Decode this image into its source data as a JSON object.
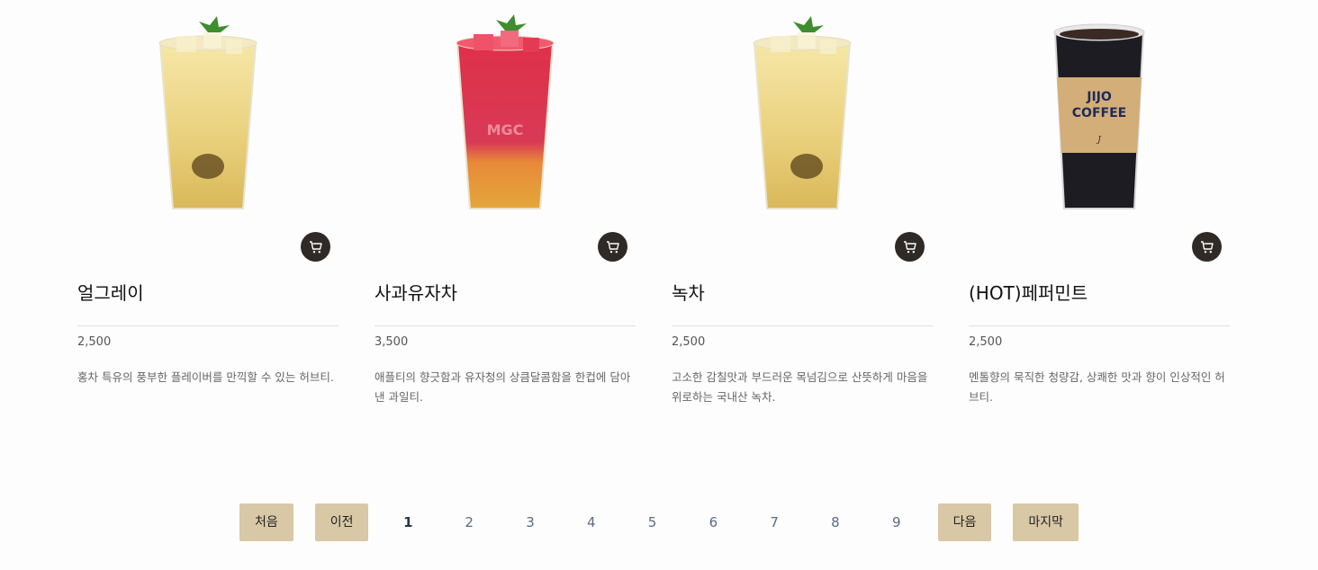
{
  "products": [
    {
      "name": "얼그레이",
      "price": "2,500",
      "description": "홍차 특유의 풍부한 플레이버를 만끽할 수 있는 허브티.",
      "image_icon": "iced-earl-grey-tea-drink"
    },
    {
      "name": "사과유자차",
      "price": "3,500",
      "description": "애플티의 향긋함과 유자청의 상큼달콤함을 한컵에 담아낸 과일티.",
      "image_icon": "iced-apple-yuzu-tea-drink",
      "cup_logo": "MGC"
    },
    {
      "name": "녹차",
      "price": "2,500",
      "description": "고소한 감칠맛과 부드러운 목넘김으로 산뜻하게 마음을 위로하는 국내산 녹차.",
      "image_icon": "iced-green-tea-drink"
    },
    {
      "name": "(HOT)페퍼민트",
      "price": "2,500",
      "description": "멘톨향의 묵직한 청량감, 상쾌한 맛과 향이 인상적인 허브티.",
      "image_icon": "hot-coffee-cup",
      "cup_logo": "JIJO COFFEE"
    }
  ],
  "cart_icon": "cart-icon",
  "pagination": {
    "first": "처음",
    "prev": "이전",
    "pages": [
      "1",
      "2",
      "3",
      "4",
      "5",
      "6",
      "7",
      "8",
      "9"
    ],
    "current": "1",
    "next": "다음",
    "last": "마지막"
  },
  "colors": {
    "cart_button": "#2f2a26",
    "pager_button": "#d9c8a6",
    "page_number": "#5a6b84"
  }
}
